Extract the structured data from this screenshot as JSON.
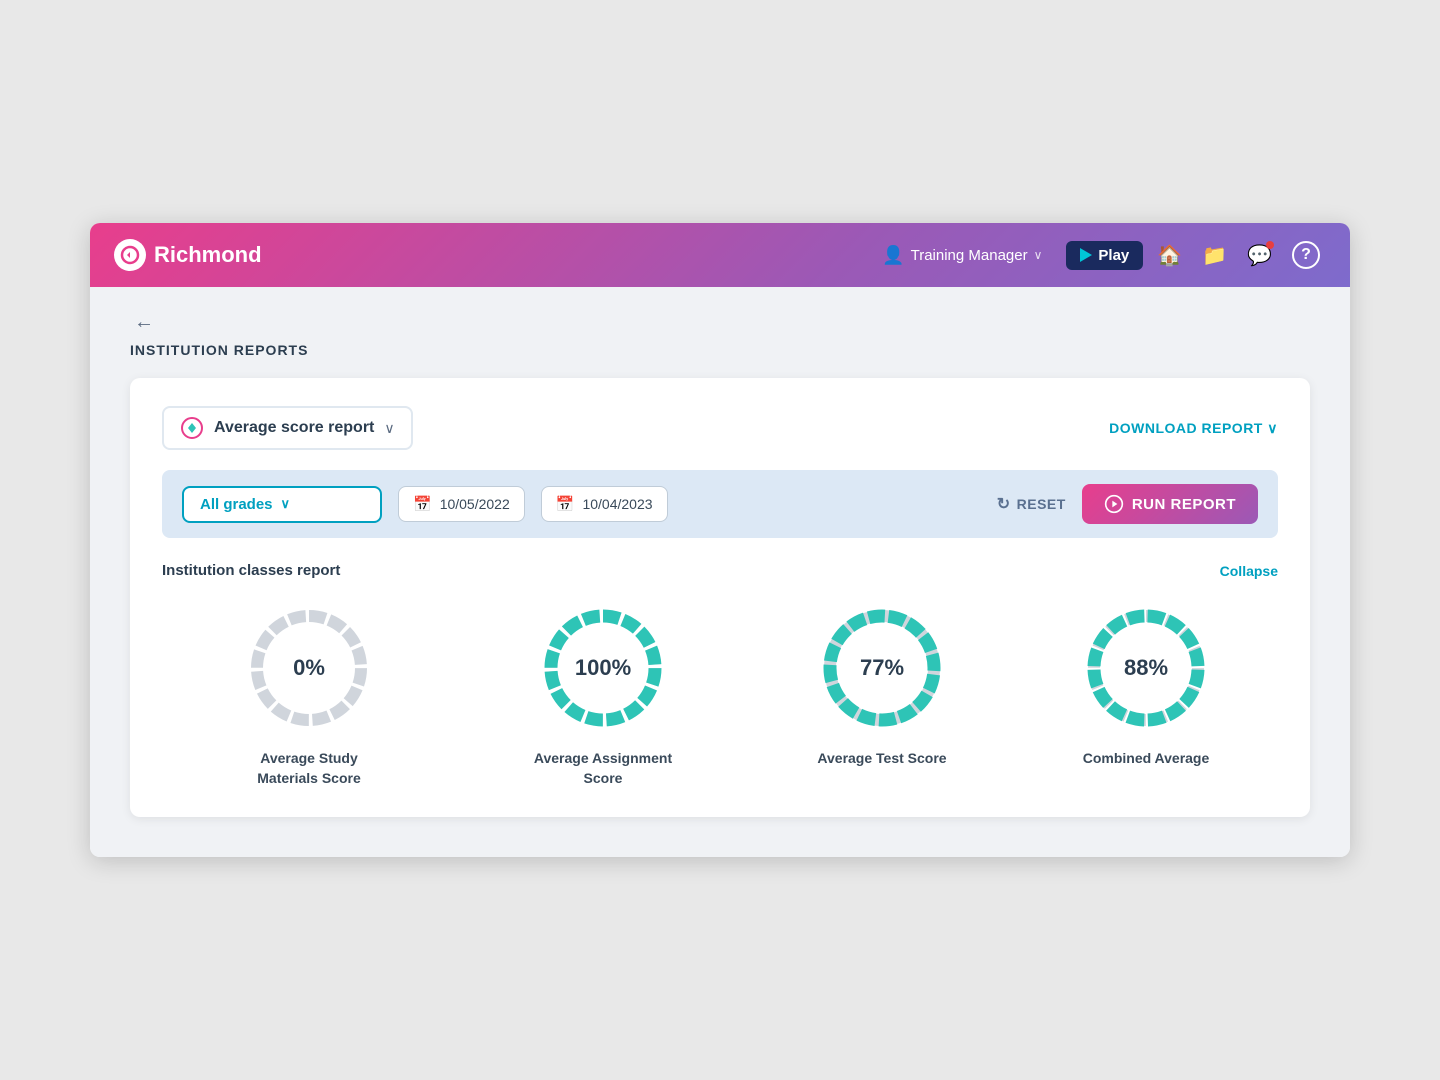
{
  "navbar": {
    "brand_name": "Richmond",
    "user_label": "Training Manager",
    "play_label": "Play",
    "nav_icons": [
      "home",
      "folder",
      "message",
      "help"
    ]
  },
  "page": {
    "back_label": "←",
    "breadcrumb": "INSTITUTION REPORTS"
  },
  "report_selector": {
    "label": "Average score report",
    "chevron": "∨",
    "download_label": "DOWNLOAD REPORT ∨"
  },
  "filter_bar": {
    "grade_label": "All grades",
    "grade_chevron": "∨",
    "date_from": "10/05/2022",
    "date_to": "10/04/2023",
    "reset_label": "RESET",
    "run_report_label": "RUN REPORT"
  },
  "classes_report": {
    "title": "Institution classes report",
    "collapse_label": "Collapse",
    "charts": [
      {
        "id": "study-materials",
        "value": 0,
        "label": "Average Study Materials Score",
        "color_bg": "#d0d5dc",
        "color_fg": "#d0d5dc",
        "percent": 0
      },
      {
        "id": "assignment",
        "value": 100,
        "label": "Average Assignment Score",
        "color_bg": "#d0d5dc",
        "color_fg": "#2ec4b6",
        "percent": 100
      },
      {
        "id": "test",
        "value": 77,
        "label": "Average Test Score",
        "color_bg": "#d0d5dc",
        "color_fg": "#2ec4b6",
        "percent": 77
      },
      {
        "id": "combined",
        "value": 88,
        "label": "Combined Average",
        "color_bg": "#d0d5dc",
        "color_fg": "#2ec4b6",
        "percent": 88
      }
    ]
  }
}
